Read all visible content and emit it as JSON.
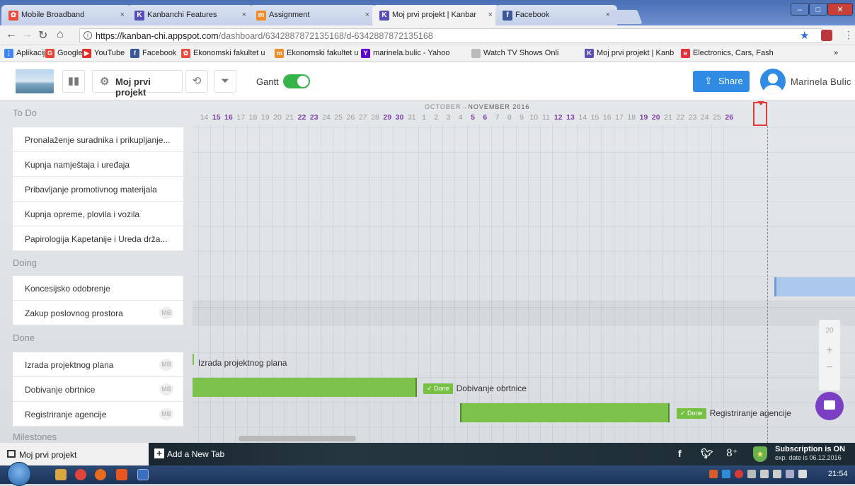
{
  "browser": {
    "tabs": [
      {
        "title": "Mobile Broadband",
        "icon": "mobile-broadband-icon",
        "color": "#e94b3c"
      },
      {
        "title": "Kanbanchi Features",
        "icon": "kanbanchi-icon",
        "color": "#5a4fb8"
      },
      {
        "title": "Assignment",
        "icon": "assignment-icon",
        "color": "#f28c28"
      },
      {
        "title": "Moj prvi projekt | Kanbar",
        "icon": "kanbanchi-icon",
        "color": "#5a4fb8"
      },
      {
        "title": "Facebook",
        "icon": "facebook-icon",
        "color": "#3b5998"
      }
    ],
    "close_glyph": "×",
    "url_host": "https://kanban-chi.appspot.com",
    "url_path": "/dashboard/6342887872135168/d-6342887872135168",
    "bookmarks": [
      {
        "label": "Aplikacije",
        "icon": "apps-icon",
        "color": "#4285f4"
      },
      {
        "label": "Google",
        "icon": "google-icon",
        "color": "#ea4335"
      },
      {
        "label": "YouTube",
        "icon": "youtube-icon",
        "color": "#e52d27"
      },
      {
        "label": "Facebook",
        "icon": "facebook-icon",
        "color": "#3b5998"
      },
      {
        "label": "Ekonomski fakultet u",
        "icon": "efst-icon",
        "color": "#e94b3c"
      },
      {
        "label": "Ekonomski fakultet u",
        "icon": "efst-icon",
        "color": "#f28c28"
      },
      {
        "label": "marinela.bulic - Yahoo",
        "icon": "yahoo-icon",
        "color": "#5f01d1"
      },
      {
        "label": "Watch TV Shows Onli",
        "icon": "page-icon",
        "color": "#888888"
      },
      {
        "label": "Moj prvi projekt | Kanb",
        "icon": "kanbanchi-icon",
        "color": "#5a4fb8"
      },
      {
        "label": "Electronics, Cars, Fash",
        "icon": "ebay-icon",
        "color": "#e53238"
      }
    ],
    "more_bookmarks": "»"
  },
  "app": {
    "project_name": "Moj prvi projekt",
    "gantt_label": "Gantt",
    "gantt_on": true,
    "share_label": "Share",
    "user_name": "Marinela Bulic"
  },
  "lists": {
    "todo": {
      "title": "To Do",
      "cards": [
        {
          "title": "Pronalaženje suradnika i prikupljanje..."
        },
        {
          "title": "Kupnja namještaja i uređaja"
        },
        {
          "title": "Pribavljanje promotivnog materijala"
        },
        {
          "title": "Kupnja opreme, plovila i vozila"
        },
        {
          "title": "Papirologija Kapetanije i Ureda drža..."
        }
      ]
    },
    "doing": {
      "title": "Doing",
      "cards": [
        {
          "title": "Koncesijsko odobrenje"
        },
        {
          "title": "Zakup poslovnog prostora",
          "assignee": "MB"
        }
      ]
    },
    "done": {
      "title": "Done",
      "cards": [
        {
          "title": "Izrada projektnog plana",
          "assignee": "MB"
        },
        {
          "title": "Dobivanje obrtnice",
          "assignee": "MB"
        },
        {
          "title": "Registriranje agencije",
          "assignee": "MB"
        }
      ]
    },
    "milestones": {
      "title": "Milestones"
    }
  },
  "gantt": {
    "month_oct": "OCTOBER",
    "month_nov": "NOVEMBER 2016",
    "arrow": "→",
    "days": [
      "14",
      "15",
      "16",
      "17",
      "18",
      "19",
      "20",
      "21",
      "22",
      "23",
      "24",
      "25",
      "26",
      "27",
      "28",
      "29",
      "30",
      "31",
      "1",
      "2",
      "3",
      "4",
      "5",
      "6",
      "7",
      "8",
      "9",
      "10",
      "11",
      "12",
      "13",
      "14",
      "15",
      "16",
      "17",
      "18",
      "19",
      "20",
      "21",
      "22",
      "23",
      "24",
      "25",
      "26"
    ],
    "weekend_days_index": [
      1,
      2,
      8,
      9,
      15,
      16,
      22,
      23,
      29,
      30,
      36,
      37,
      43
    ],
    "today": "20",
    "bars": [
      {
        "label": "Izrada projektnog plana",
        "done": false
      },
      {
        "label": "Dobivanje obrtnice",
        "done": true,
        "done_label": "Done"
      },
      {
        "label": "Registriranje agencije",
        "done": true,
        "done_label": "Done"
      }
    ],
    "zoom_value": "20",
    "zoom_in": "+",
    "zoom_out": "−",
    "colors": {
      "green": "#7cc24b",
      "blue": "#a9c8ea",
      "today": "#e53935"
    }
  },
  "bottom": {
    "board_tab": "Moj prvi projekt",
    "add_tab": "Add a New Tab",
    "social": [
      "f",
      "8⁺"
    ],
    "subscription": "Subscription is ON",
    "expiry": "exp. date is 06.12.2016"
  },
  "taskbar": {
    "time": "21:54"
  }
}
